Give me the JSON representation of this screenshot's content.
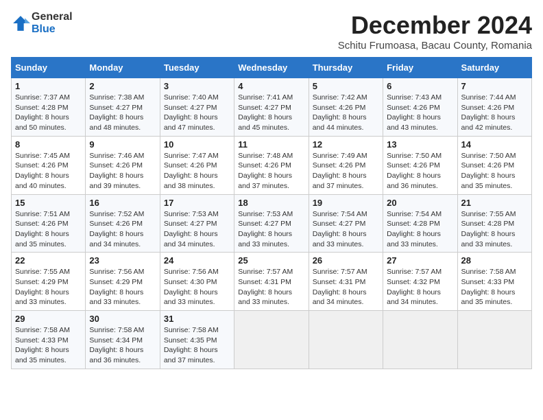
{
  "logo": {
    "general": "General",
    "blue": "Blue"
  },
  "title": "December 2024",
  "subtitle": "Schitu Frumoasa, Bacau County, Romania",
  "weekdays": [
    "Sunday",
    "Monday",
    "Tuesday",
    "Wednesday",
    "Thursday",
    "Friday",
    "Saturday"
  ],
  "weeks": [
    [
      {
        "day": 1,
        "sunrise": "7:37 AM",
        "sunset": "4:28 PM",
        "daylight": "8 hours and 50 minutes."
      },
      {
        "day": 2,
        "sunrise": "7:38 AM",
        "sunset": "4:27 PM",
        "daylight": "8 hours and 48 minutes."
      },
      {
        "day": 3,
        "sunrise": "7:40 AM",
        "sunset": "4:27 PM",
        "daylight": "8 hours and 47 minutes."
      },
      {
        "day": 4,
        "sunrise": "7:41 AM",
        "sunset": "4:27 PM",
        "daylight": "8 hours and 45 minutes."
      },
      {
        "day": 5,
        "sunrise": "7:42 AM",
        "sunset": "4:26 PM",
        "daylight": "8 hours and 44 minutes."
      },
      {
        "day": 6,
        "sunrise": "7:43 AM",
        "sunset": "4:26 PM",
        "daylight": "8 hours and 43 minutes."
      },
      {
        "day": 7,
        "sunrise": "7:44 AM",
        "sunset": "4:26 PM",
        "daylight": "8 hours and 42 minutes."
      }
    ],
    [
      {
        "day": 8,
        "sunrise": "7:45 AM",
        "sunset": "4:26 PM",
        "daylight": "8 hours and 40 minutes."
      },
      {
        "day": 9,
        "sunrise": "7:46 AM",
        "sunset": "4:26 PM",
        "daylight": "8 hours and 39 minutes."
      },
      {
        "day": 10,
        "sunrise": "7:47 AM",
        "sunset": "4:26 PM",
        "daylight": "8 hours and 38 minutes."
      },
      {
        "day": 11,
        "sunrise": "7:48 AM",
        "sunset": "4:26 PM",
        "daylight": "8 hours and 37 minutes."
      },
      {
        "day": 12,
        "sunrise": "7:49 AM",
        "sunset": "4:26 PM",
        "daylight": "8 hours and 37 minutes."
      },
      {
        "day": 13,
        "sunrise": "7:50 AM",
        "sunset": "4:26 PM",
        "daylight": "8 hours and 36 minutes."
      },
      {
        "day": 14,
        "sunrise": "7:50 AM",
        "sunset": "4:26 PM",
        "daylight": "8 hours and 35 minutes."
      }
    ],
    [
      {
        "day": 15,
        "sunrise": "7:51 AM",
        "sunset": "4:26 PM",
        "daylight": "8 hours and 35 minutes."
      },
      {
        "day": 16,
        "sunrise": "7:52 AM",
        "sunset": "4:26 PM",
        "daylight": "8 hours and 34 minutes."
      },
      {
        "day": 17,
        "sunrise": "7:53 AM",
        "sunset": "4:27 PM",
        "daylight": "8 hours and 34 minutes."
      },
      {
        "day": 18,
        "sunrise": "7:53 AM",
        "sunset": "4:27 PM",
        "daylight": "8 hours and 33 minutes."
      },
      {
        "day": 19,
        "sunrise": "7:54 AM",
        "sunset": "4:27 PM",
        "daylight": "8 hours and 33 minutes."
      },
      {
        "day": 20,
        "sunrise": "7:54 AM",
        "sunset": "4:28 PM",
        "daylight": "8 hours and 33 minutes."
      },
      {
        "day": 21,
        "sunrise": "7:55 AM",
        "sunset": "4:28 PM",
        "daylight": "8 hours and 33 minutes."
      }
    ],
    [
      {
        "day": 22,
        "sunrise": "7:55 AM",
        "sunset": "4:29 PM",
        "daylight": "8 hours and 33 minutes."
      },
      {
        "day": 23,
        "sunrise": "7:56 AM",
        "sunset": "4:29 PM",
        "daylight": "8 hours and 33 minutes."
      },
      {
        "day": 24,
        "sunrise": "7:56 AM",
        "sunset": "4:30 PM",
        "daylight": "8 hours and 33 minutes."
      },
      {
        "day": 25,
        "sunrise": "7:57 AM",
        "sunset": "4:31 PM",
        "daylight": "8 hours and 33 minutes."
      },
      {
        "day": 26,
        "sunrise": "7:57 AM",
        "sunset": "4:31 PM",
        "daylight": "8 hours and 34 minutes."
      },
      {
        "day": 27,
        "sunrise": "7:57 AM",
        "sunset": "4:32 PM",
        "daylight": "8 hours and 34 minutes."
      },
      {
        "day": 28,
        "sunrise": "7:58 AM",
        "sunset": "4:33 PM",
        "daylight": "8 hours and 35 minutes."
      }
    ],
    [
      {
        "day": 29,
        "sunrise": "7:58 AM",
        "sunset": "4:33 PM",
        "daylight": "8 hours and 35 minutes."
      },
      {
        "day": 30,
        "sunrise": "7:58 AM",
        "sunset": "4:34 PM",
        "daylight": "8 hours and 36 minutes."
      },
      {
        "day": 31,
        "sunrise": "7:58 AM",
        "sunset": "4:35 PM",
        "daylight": "8 hours and 37 minutes."
      },
      null,
      null,
      null,
      null
    ]
  ],
  "labels": {
    "sunrise": "Sunrise:",
    "sunset": "Sunset:",
    "daylight": "Daylight:"
  }
}
